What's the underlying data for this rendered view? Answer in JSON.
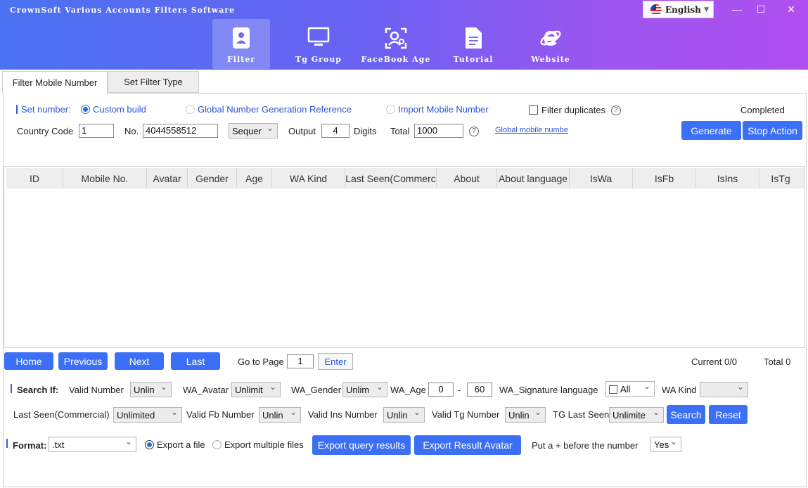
{
  "app": {
    "title": "CrownSoft Various Accounts Filters Software",
    "language": "English",
    "window_controls": {
      "minimize": "—",
      "maximize": "☐",
      "close": "✕"
    }
  },
  "nav": [
    {
      "label": "Filter",
      "icon": "contact-book-icon"
    },
    {
      "label": "Tg Group",
      "icon": "monitor-icon"
    },
    {
      "label": "FaceBook Age",
      "icon": "user-scan-icon"
    },
    {
      "label": "Tutorial",
      "icon": "document-icon"
    },
    {
      "label": "Website",
      "icon": "internet-explorer-icon"
    }
  ],
  "tabs": [
    "Filter Mobile Number",
    "Set Filter Type"
  ],
  "set_number": {
    "label": "Set number:",
    "options": [
      "Custom build",
      "Global Number Generation Reference",
      "Import Mobile Number"
    ],
    "filter_duplicates": "Filter duplicates",
    "status": "Completed",
    "country_code_label": "Country Code",
    "country_code": "1",
    "no_label": "No.",
    "no_value": "4044558512",
    "order": "Sequer",
    "output_label": "Output",
    "output_value": "4",
    "digits_label": "Digits",
    "total_label": "Total",
    "total_value": "1000",
    "global_link": "Global mobile numbe",
    "generate": "Generate",
    "stop": "Stop Action"
  },
  "table": {
    "columns": [
      "ID",
      "Mobile No.",
      "Avatar",
      "Gender",
      "Age",
      "WA Kind",
      "Last Seen(Commerc",
      "About",
      "About language",
      "IsWa",
      "IsFb",
      "IsIns",
      "IsTg"
    ]
  },
  "pager": {
    "home": "Home",
    "previous": "Previous",
    "next": "Next",
    "last": "Last",
    "go_to_page": "Go to Page",
    "page": "1",
    "enter": "Enter",
    "current": "Current 0/0",
    "total": "Total 0"
  },
  "search": {
    "label": "Search If:",
    "valid_number_label": "Valid Number",
    "valid_number": "Unlin",
    "wa_avatar_label": "WA_Avatar",
    "wa_avatar": "Unlimit",
    "wa_gender_label": "WA_Gender",
    "wa_gender": "Unlim",
    "wa_age_label": "WA_Age",
    "age_from": "0",
    "age_dash": "-",
    "age_to": "60",
    "wa_sig_label": "WA_Signature language",
    "wa_sig": "All",
    "wa_kind_label": "WA Kind",
    "wa_kind": "",
    "last_seen_label": "Last Seen(Commercial)",
    "last_seen": "Unlimited",
    "valid_fb_label": "Valid Fb Number",
    "valid_fb": "Unlin",
    "valid_ins_label": "Valid Ins Number",
    "valid_ins": "Unlin",
    "valid_tg_label": "Valid Tg Number",
    "valid_tg": "Unlin",
    "tg_last_seen_label": "TG Last Seen",
    "tg_last_seen": "Unlimite",
    "search_btn": "Search",
    "reset_btn": "Reset"
  },
  "format": {
    "label": "Format:",
    "value": ".txt",
    "export_single": "Export a file",
    "export_multi": "Export multiple files",
    "export_query": "Export query results",
    "export_avatar": "Export Result Avatar",
    "plus_label": "Put a + before the number",
    "plus_value": "Yes"
  }
}
